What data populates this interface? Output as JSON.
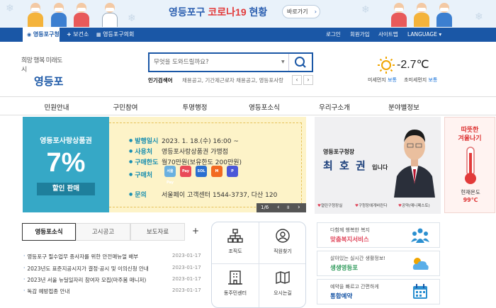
{
  "banner": {
    "title_blue": "영등포구",
    "title_red": "코로나19",
    "title_tail": "현황",
    "button": "바로가기",
    "button_arrow": "›"
  },
  "topbar": {
    "tabs": [
      "영등포구청",
      "보건소",
      "영등포구의회"
    ],
    "links": [
      "로그인",
      "회원가입",
      "사이트맵",
      "LANGUAGE ▾"
    ]
  },
  "header": {
    "logo_line1": "희망 행복 미래도시",
    "logo_line2": "영등포",
    "search_placeholder": "무엇을 도와드릴까요?",
    "popular_label": "인기검색어",
    "popular_text": "채용공고, 기간제근로자 채용공고, 영등포사랑",
    "weather_temp": "-2.7℃",
    "dust_label": "미세먼지",
    "dust_value": "보통",
    "ultra_label": "초미세먼지",
    "ultra_value": "보통"
  },
  "gnb": [
    "민원안내",
    "구민참여",
    "투명행정",
    "영등포소식",
    "우리구소개",
    "분야별정보"
  ],
  "main_banner": {
    "left_title": "영등포사랑상품권",
    "left_big": "7%",
    "left_sub": "할인 판매",
    "rows": [
      {
        "k": "발행일시",
        "v": "2023. 1. 18.(수) 16:00 ~"
      },
      {
        "k": "사용처",
        "v": "영등포사랑상품권 가맹점"
      },
      {
        "k": "구매한도",
        "v": "월70만원(보유한도 200만원)"
      },
      {
        "k": "구매처",
        "v": ""
      },
      {
        "k": "문의",
        "v": "서울페이 고객센터 1544-3737, 다산 120"
      }
    ],
    "pay_icons": [
      "서울Pay",
      "Pay",
      "SOL",
      "M",
      "P"
    ],
    "control": "1/6",
    "control_prev": "‹",
    "control_pause": "II",
    "control_next": "›"
  },
  "mayor": {
    "title": "영등포구청장",
    "name": "최 호 권",
    "suffix": "입니다",
    "links": [
      "열린구청장실",
      "구청장에게바란다",
      "공약(매니페스토)"
    ]
  },
  "warm": {
    "title_line1": "따뜻한",
    "title_line2": "겨울나기",
    "label": "현재온도",
    "value": "99℃"
  },
  "news": {
    "tabs": [
      "영등포소식",
      "고시공고",
      "보도자료"
    ],
    "plus": "+",
    "items": [
      {
        "title": "영등포구 필수업무 종사자를 위한 안전매뉴얼 배부",
        "date": "2023-01-17"
      },
      {
        "title": "2023년도 표준지공시지가 결정·공시 및 이의신청 안내",
        "date": "2023-01-17"
      },
      {
        "title": "2023년 서울 뉴딜일자리 참여자 모집(마주봄 매니저)",
        "date": "2023-01-17"
      },
      {
        "title": "독감 예방접종 안내",
        "date": "2023-01-17"
      }
    ]
  },
  "quick": [
    "조직도",
    "직원찾기",
    "동주민센터",
    "오시는길"
  ],
  "services": [
    {
      "line1": "다함께 행복한 복지",
      "line2": "맞춤복지서비스",
      "color": "#e0455a"
    },
    {
      "line1": "살아있는 실시간 생활정보!",
      "line2": "생생영등포",
      "color": "#2e9a5a"
    },
    {
      "line1": "예약을 빠르고 간편하게",
      "line2": "통합예약",
      "color": "#1a57a6"
    }
  ],
  "colors": {
    "brand": "#1a57a6",
    "banner_teal": "#36a8c6",
    "banner_cream": "#fdf3c8"
  }
}
